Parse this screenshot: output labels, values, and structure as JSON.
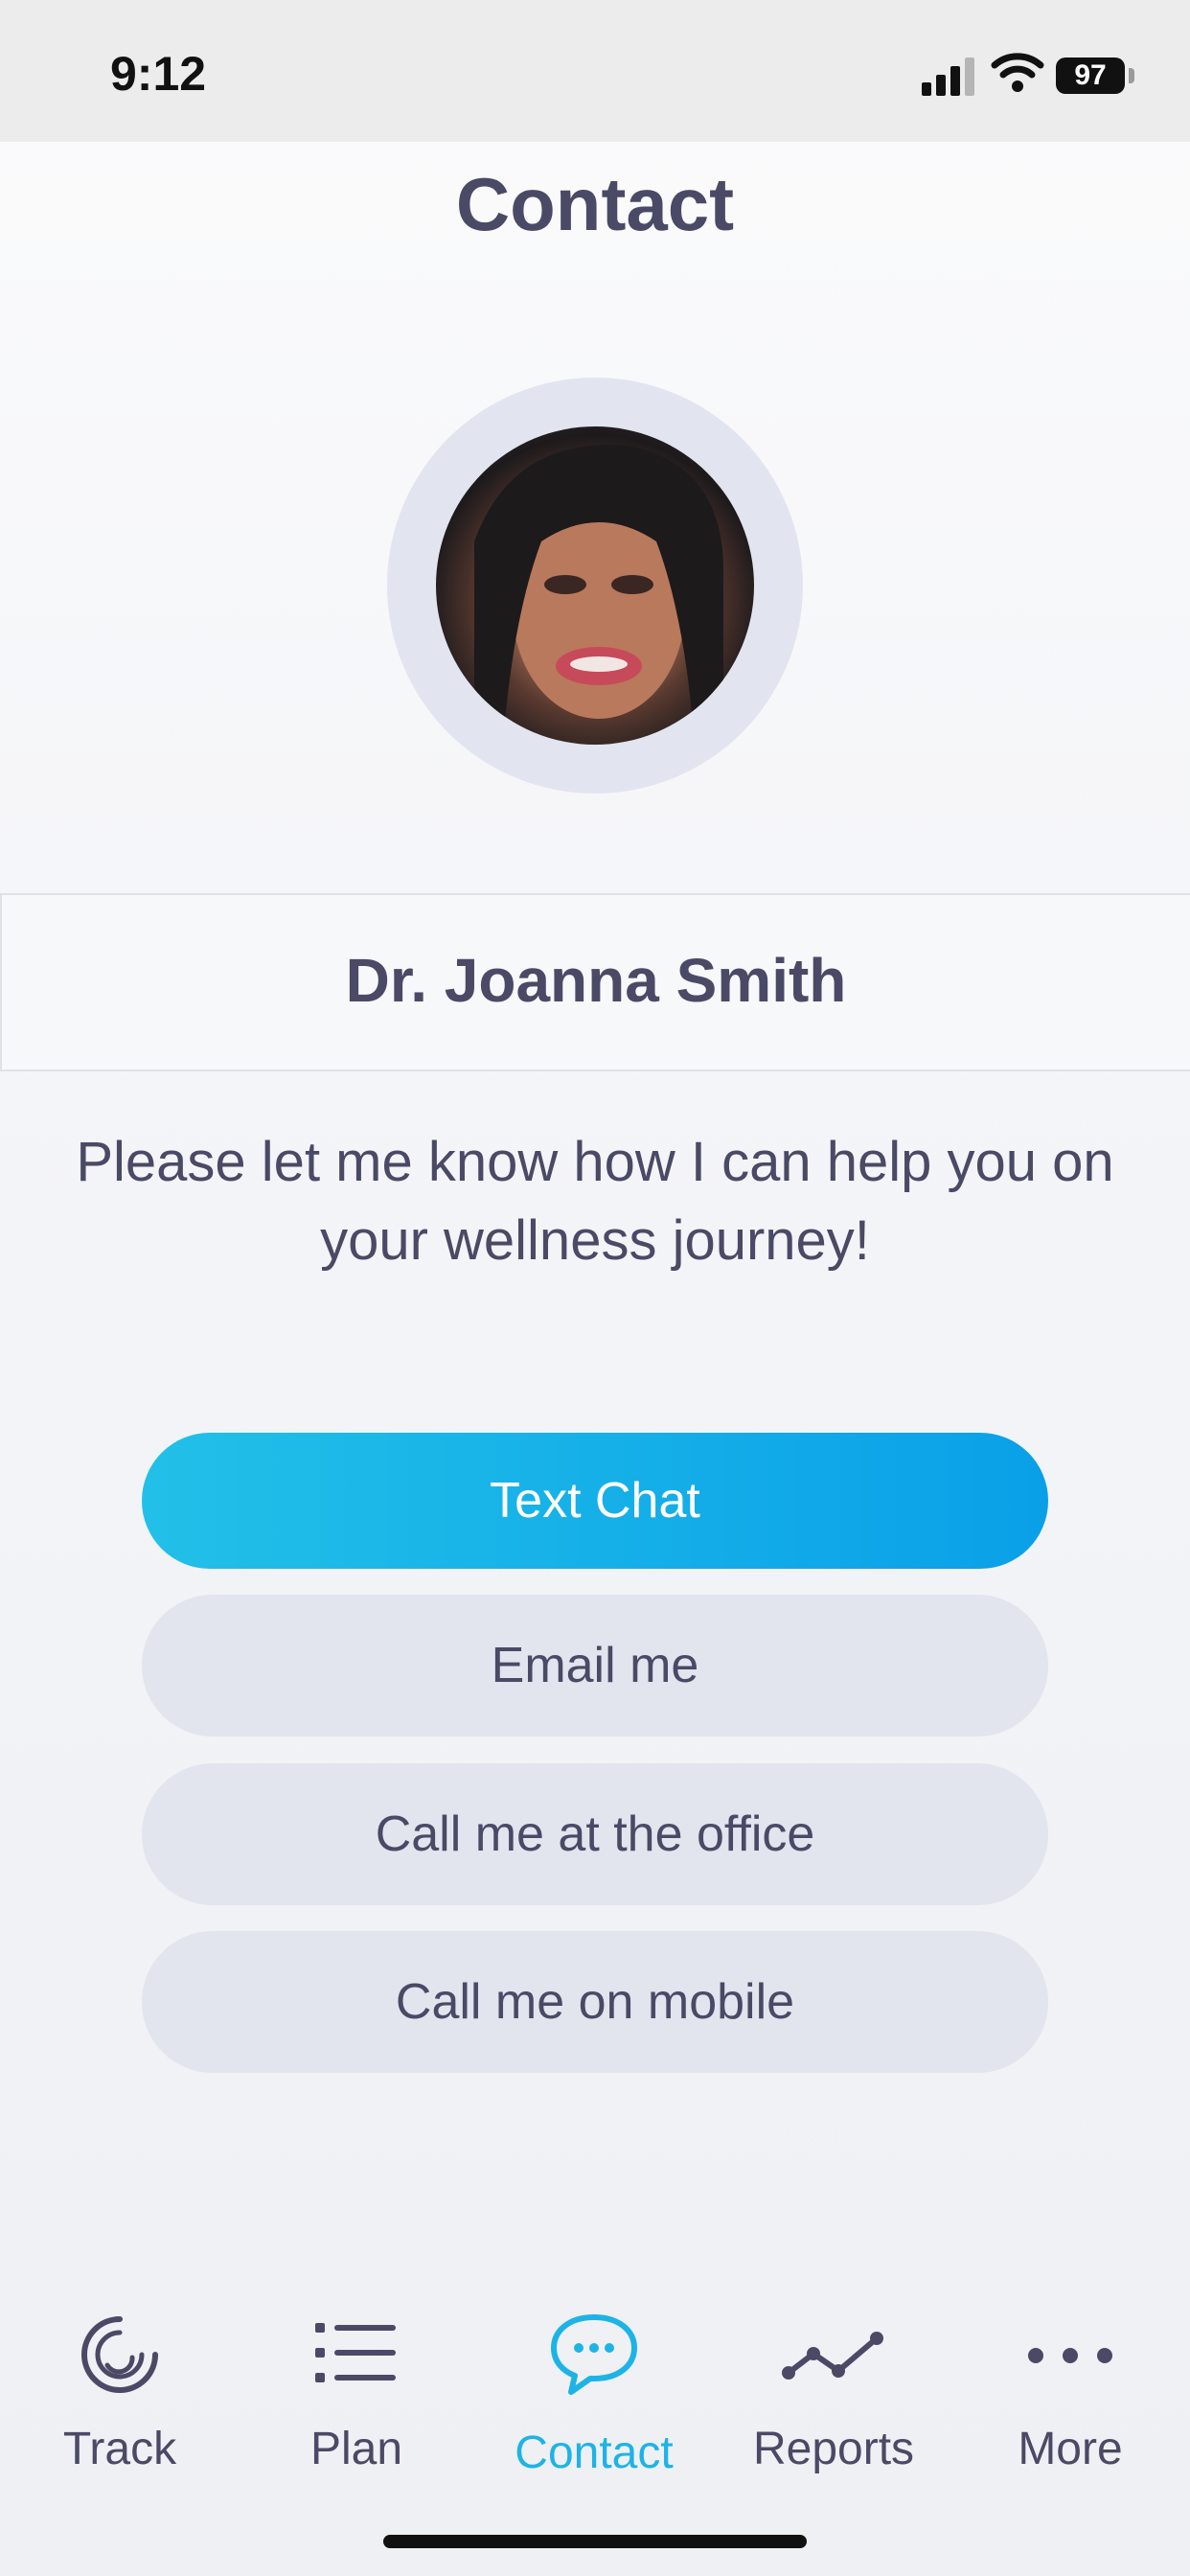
{
  "status_bar": {
    "time": "9:12",
    "battery": "97",
    "icons": [
      "cellular-signal-icon",
      "wifi-icon",
      "battery-icon"
    ]
  },
  "header": {
    "title": "Contact"
  },
  "profile": {
    "name": "Dr. Joanna Smith",
    "message": "Please let me know how I can help you on your wellness journey!"
  },
  "actions": {
    "text_chat": "Text Chat",
    "email": "Email me",
    "call_office": "Call me at the office",
    "call_mobile": "Call me on mobile"
  },
  "tabs": [
    {
      "label": "Track",
      "icon": "track-icon"
    },
    {
      "label": "Plan",
      "icon": "list-icon"
    },
    {
      "label": "Contact",
      "icon": "chat-bubble-icon",
      "active": true
    },
    {
      "label": "Reports",
      "icon": "line-chart-icon"
    },
    {
      "label": "More",
      "icon": "more-dots-icon"
    }
  ],
  "colors": {
    "accent": "#1eb3e6",
    "primary_text": "#4a4a66",
    "secondary_button": "#e2e4ee"
  }
}
